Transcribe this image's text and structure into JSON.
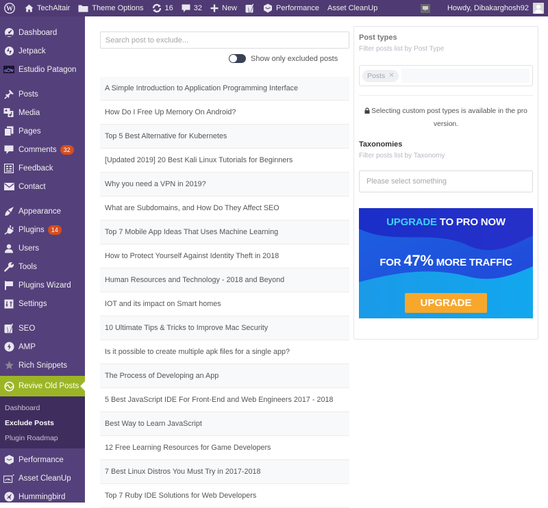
{
  "adminbar": {
    "site_name": "TechAltair",
    "theme_options": "Theme Options",
    "updates_count": "16",
    "comments_count": "32",
    "new_label": "New",
    "performance": "Performance",
    "asset_cleanup": "Asset CleanUp",
    "greeting": "Howdy, Dibakarghosh92"
  },
  "sidebar": {
    "items": [
      {
        "label": "Dashboard",
        "icon": "dashboard-icon"
      },
      {
        "label": "Jetpack",
        "icon": "jetpack-icon"
      },
      {
        "label": "Estudio Patagon",
        "icon": "estudio-patagon-icon"
      },
      {
        "label": "Posts",
        "icon": "pin-icon"
      },
      {
        "label": "Media",
        "icon": "media-icon"
      },
      {
        "label": "Pages",
        "icon": "pages-icon"
      },
      {
        "label": "Comments",
        "icon": "comment-icon",
        "badge": "32"
      },
      {
        "label": "Feedback",
        "icon": "feedback-icon"
      },
      {
        "label": "Contact",
        "icon": "envelope-icon"
      },
      {
        "label": "Appearance",
        "icon": "brush-icon"
      },
      {
        "label": "Plugins",
        "icon": "plugin-icon",
        "badge": "14"
      },
      {
        "label": "Users",
        "icon": "user-icon"
      },
      {
        "label": "Tools",
        "icon": "wrench-icon"
      },
      {
        "label": "Plugins Wizard",
        "icon": "flag-icon"
      },
      {
        "label": "Settings",
        "icon": "settings-icon"
      },
      {
        "label": "SEO",
        "icon": "yoast-icon"
      },
      {
        "label": "AMP",
        "icon": "amp-icon"
      },
      {
        "label": "Rich Snippets",
        "icon": "star-icon"
      },
      {
        "label": "Revive Old Posts",
        "icon": "revive-icon"
      },
      {
        "label": "Performance",
        "icon": "performance-icon"
      },
      {
        "label": "Asset CleanUp",
        "icon": "asset-cleanup-icon"
      },
      {
        "label": "Hummingbird",
        "icon": "hummingbird-icon"
      }
    ],
    "submenu": [
      {
        "label": "Dashboard"
      },
      {
        "label": "Exclude Posts",
        "active": true
      },
      {
        "label": "Plugin Roadmap"
      }
    ]
  },
  "main": {
    "search_placeholder": "Search post to exclude...",
    "toggle_label": "Show only excluded posts",
    "toggle_on": false,
    "posts": [
      "A Simple Introduction to Application Programming Interface",
      "How Do I Free Up Memory On Android?",
      "Top 5 Best Alternative for Kubernetes",
      "[Updated 2019] 20 Best Kali Linux Tutorials for Beginners",
      "Why you need a VPN in 2019?",
      "What are Subdomains, and How Do They Affect SEO",
      "Top 7 Mobile App Ideas That Uses Machine Learning",
      "How to Protect Yourself Against Identity Theft in 2018",
      "Human Resources and Technology - 2018 and Beyond",
      "IOT and its impact on Smart homes",
      "10 Ultimate Tips & Tricks to Improve Mac Security",
      "Is it possible to create multiple apk files for a single app?",
      "The Process of Developing an App",
      "5 Best JavaScript IDE For Front-End and Web Engineers 2017 - 2018",
      "Best Way to Learn JavaScript",
      "12 Free Learning Resources for Game Developers",
      "7 Best Linux Distros You Must Try in 2017-2018",
      "Top 7 Ruby IDE Solutions for Web Developers"
    ]
  },
  "filters": {
    "post_types_title": "Post types",
    "post_types_subtitle": "Filter posts list by Post Type",
    "selected_post_type": "Posts",
    "pro_note": "Selecting custom post types is available in the pro version.",
    "taxonomies_title": "Taxonomies",
    "taxonomies_subtitle": "Filter posts list by Taxonomy",
    "taxonomies_placeholder": "Please select something"
  },
  "banner": {
    "line1_highlight": "UPGRADE",
    "line1_rest": " TO PRO NOW",
    "line2_prefix": "FOR ",
    "line2_big": "47%",
    "line2_suffix": " MORE TRAFFIC",
    "button": "UPGRADE"
  },
  "colors": {
    "adminbar_bg": "#4f3a73",
    "sidebar_bg": "#54407a",
    "current_menu": "#9cb526",
    "badge": "#d54e21",
    "upgrade_button": "#f7a72c"
  }
}
